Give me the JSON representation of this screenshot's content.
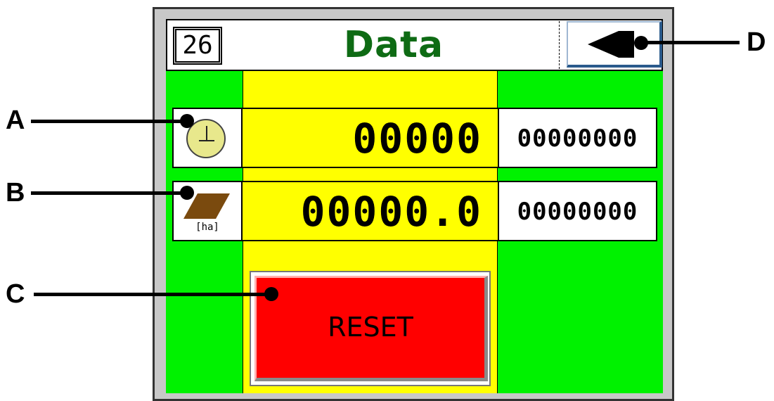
{
  "header": {
    "page_number": "26",
    "title": "Data"
  },
  "rows": [
    {
      "icon": "clock-icon",
      "value": "00000",
      "total": "00000000"
    },
    {
      "icon": "area-icon",
      "unit": "[ha]",
      "value": "00000.0",
      "total": "00000000"
    }
  ],
  "reset_label": "RESET",
  "callouts": {
    "a": "A",
    "b": "B",
    "c": "C",
    "d": "D"
  },
  "colors": {
    "background": "#00f200",
    "value_panel": "#ffff00",
    "reset": "#ff0000",
    "title": "#0e6b14",
    "area_icon": "#7a4a0e"
  }
}
